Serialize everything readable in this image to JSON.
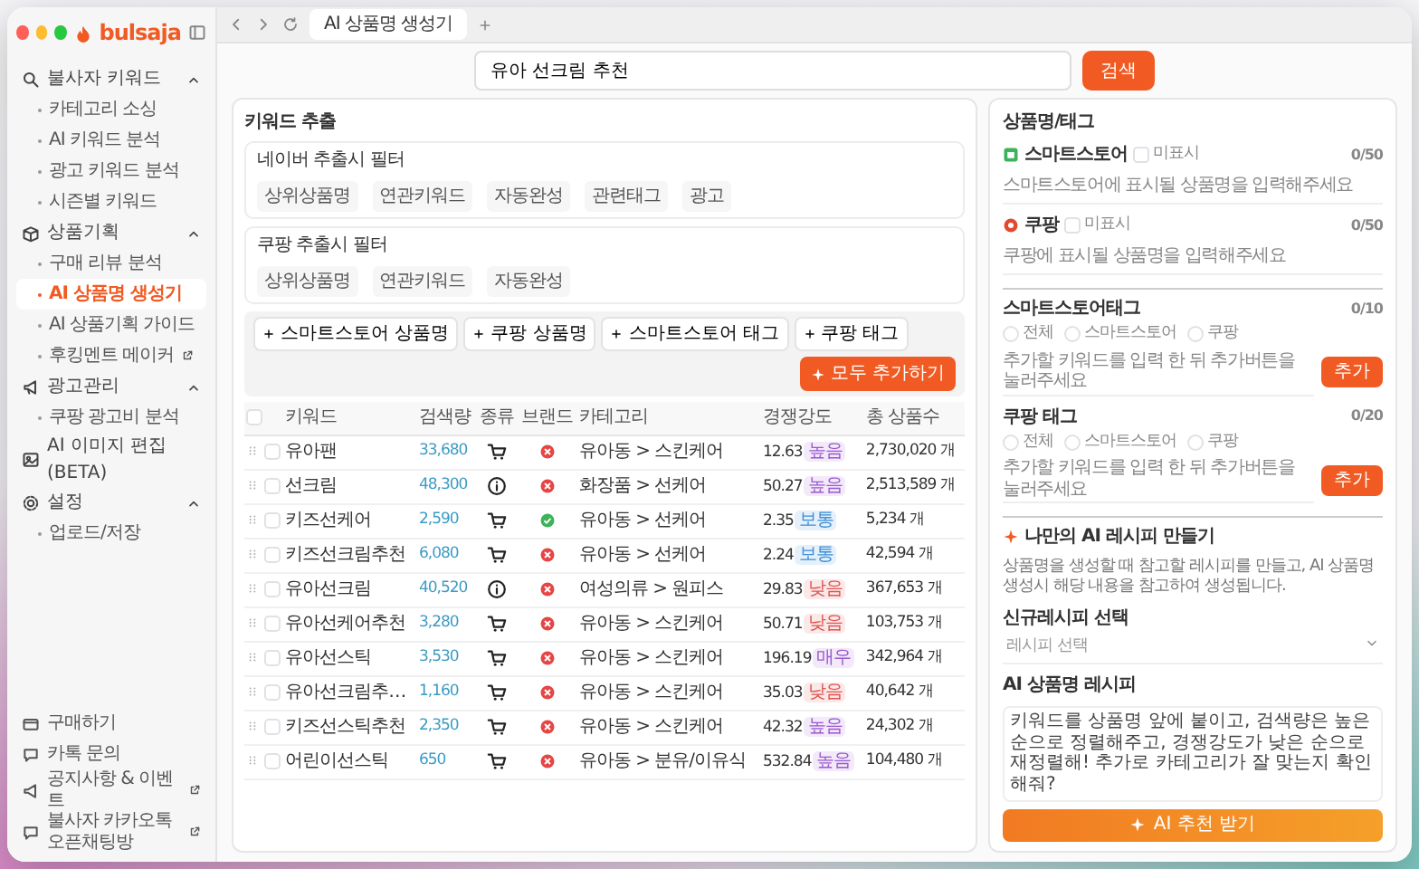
{
  "sidebar": {
    "logo": "bulsaja",
    "items": [
      {
        "label": "불사자 키워드",
        "expanded": true,
        "children": [
          {
            "label": "카테고리 소싱",
            "selected": false,
            "external": false
          },
          {
            "label": "AI 키워드 분석",
            "selected": false,
            "external": false
          },
          {
            "label": "광고 키워드 분석",
            "selected": false,
            "external": false
          },
          {
            "label": "시즌별 키워드",
            "selected": false,
            "external": false
          }
        ]
      },
      {
        "label": "상품기획",
        "expanded": true,
        "children": [
          {
            "label": "구매 리뷰 분석",
            "selected": false,
            "external": false
          },
          {
            "label": "AI 상품명 생성기",
            "selected": true,
            "external": false
          },
          {
            "label": "AI 상품기획 가이드",
            "selected": false,
            "external": false
          },
          {
            "label": "후킹멘트 메이커",
            "selected": false,
            "external": true
          }
        ]
      },
      {
        "label": "광고관리",
        "expanded": true,
        "children": [
          {
            "label": "쿠팡 광고비 분석",
            "selected": false,
            "external": false
          }
        ]
      },
      {
        "label": "AI 이미지 편집 (BETA)"
      },
      {
        "label": "설정",
        "expanded": true,
        "children": [
          {
            "label": "업로드/저장",
            "selected": false,
            "external": false
          }
        ]
      }
    ],
    "footer": [
      {
        "label": "구매하기",
        "external": false
      },
      {
        "label": "카톡 문의",
        "external": false
      },
      {
        "label": "공지사항 & 이벤트",
        "external": true
      },
      {
        "label": "불사자 카카오톡 오픈채팅방",
        "external": true
      }
    ]
  },
  "browser": {
    "tabs": [
      {
        "label": "AI 상품명 생성기",
        "selected": true
      }
    ]
  },
  "search": {
    "value": "유아 선크림 추천",
    "button": "검색"
  },
  "keyword_panel": {
    "title": "키워드 추출",
    "filters": [
      {
        "title": "네이버 추출시 필터",
        "chips": [
          "상위상품명",
          "연관키워드",
          "자동완성",
          "관련태그",
          "광고"
        ]
      },
      {
        "title": "쿠팡 추출시 필터",
        "chips": [
          "상위상품명",
          "연관키워드",
          "자동완성"
        ]
      }
    ],
    "actions": [
      "스마트스토어 상품명",
      "쿠팡 상품명",
      "스마트스토어 태그",
      "쿠팡 태그"
    ],
    "add_all": "모두 추가하기",
    "table": {
      "all_checked": false,
      "columns": [
        "키워드",
        "검색량",
        "종류",
        "브랜드",
        "카테고리",
        "경쟁강도",
        "총 상품수"
      ],
      "rows": [
        {
          "checked": false,
          "keyword": "유아팬",
          "volume": "33,680",
          "kind": "shopping",
          "brand": false,
          "category": "유아동 > 스킨케어",
          "competition": "12.63",
          "badge": {
            "label": "높음",
            "color": "#9b59d0"
          },
          "total": "2,730,020 개"
        },
        {
          "checked": false,
          "keyword": "선크림",
          "volume": "48,300",
          "kind": "info",
          "brand": false,
          "category": "화장품 > 선케어",
          "competition": "50.27",
          "badge": {
            "label": "높음",
            "color": "#9b59d0"
          },
          "total": "2,513,589 개"
        },
        {
          "checked": false,
          "keyword": "키즈선케어",
          "volume": "2,590",
          "kind": "shopping",
          "brand": true,
          "category": "유아동 > 선케어",
          "competition": "2.35",
          "badge": {
            "label": "보통",
            "color": "#3b8fd9"
          },
          "total": "5,234 개"
        },
        {
          "checked": false,
          "keyword": "키즈선크림추천",
          "volume": "6,080",
          "kind": "shopping",
          "brand": false,
          "category": "유아동 > 선케어",
          "competition": "2.24",
          "badge": {
            "label": "보통",
            "color": "#3b8fd9"
          },
          "total": "42,594 개"
        },
        {
          "checked": false,
          "keyword": "유아선크림",
          "volume": "40,520",
          "kind": "info",
          "brand": false,
          "category": "여성의류 > 원피스",
          "competition": "29.83",
          "badge": {
            "label": "낮음",
            "color": "#e0554f"
          },
          "total": "367,653 개"
        },
        {
          "checked": false,
          "keyword": "유아선케어추천",
          "volume": "3,280",
          "kind": "shopping",
          "brand": false,
          "category": "유아동 > 스킨케어",
          "competition": "50.71",
          "badge": {
            "label": "낮음",
            "color": "#e0554f"
          },
          "total": "103,753 개"
        },
        {
          "checked": false,
          "keyword": "유아선스틱",
          "volume": "3,530",
          "kind": "shopping",
          "brand": false,
          "category": "유아동 > 스킨케어",
          "competition": "196.19",
          "badge": {
            "label": "매우",
            "color": "#9b59d0"
          },
          "total": "342,964 개"
        },
        {
          "checked": false,
          "keyword": "유아선크림추…",
          "volume": "1,160",
          "kind": "shopping",
          "brand": false,
          "category": "유아동 > 스킨케어",
          "competition": "35.03",
          "badge": {
            "label": "낮음",
            "color": "#e0554f"
          },
          "total": "40,642 개"
        },
        {
          "checked": false,
          "keyword": "키즈선스틱추천",
          "volume": "2,350",
          "kind": "shopping",
          "brand": false,
          "category": "유아동 > 스킨케어",
          "competition": "42.32",
          "badge": {
            "label": "높음",
            "color": "#9b59d0"
          },
          "total": "24,302 개"
        },
        {
          "checked": false,
          "keyword": "어린이선스틱",
          "volume": "650",
          "kind": "shopping",
          "brand": false,
          "category": "유아동 > 분유/이유식",
          "competition": "532.84",
          "badge": {
            "label": "높음",
            "color": "#9b59d0"
          },
          "total": "104,480 개"
        }
      ]
    }
  },
  "product_panel": {
    "title": "상품명/태그",
    "names": [
      {
        "label": "스마트스토어",
        "option": "미표시",
        "checked": false,
        "count": "0/50",
        "placeholder": "스마트스토어에 표시될 상품명을 입력해주세요"
      },
      {
        "label": "쿠팡",
        "option": "미표시",
        "checked": false,
        "count": "0/50",
        "placeholder": "쿠팡에 표시될 상품명을 입력해주세요"
      }
    ],
    "tags": [
      {
        "label": "스마트스토어태그",
        "options": [
          {
            "label": "전체",
            "selected": false
          },
          {
            "label": "스마트스토어",
            "selected": false
          },
          {
            "label": "쿠팡",
            "selected": false
          }
        ],
        "count": "0/10",
        "placeholder": "추가할 키워드를 입력 한 뒤 추가버튼을 눌러주세요",
        "button": "추가"
      },
      {
        "label": "쿠팡 태그",
        "options": [
          {
            "label": "전체",
            "selected": false
          },
          {
            "label": "스마트스토어",
            "selected": false
          },
          {
            "label": "쿠팡",
            "selected": false
          }
        ],
        "count": "0/20",
        "placeholder": "추가할 키워드를 입력 한 뒤 추가버튼을 눌러주세요",
        "button": "추가"
      }
    ]
  },
  "recipe": {
    "title": "나만의 AI 레시피 만들기",
    "description": "상품명을 생성할 때 참고할 레시피를 만들고, AI 상품명 생성시 해당 내용을 참고하여 생성됩니다.",
    "select_label": "신규레시피 선택",
    "select_placeholder": "레시피 선택",
    "prompt_label": "AI 상품명 레시피",
    "prompt": "키워드를 상품명 앞에 붙이고, 검색량은 높은 순으로 정렬해주고, 경쟁강도가 낮은 순으로 재정렬해! 추가로 카테고리가 잘 맞는지 확인해줘?",
    "button": "AI 추천 받기"
  }
}
